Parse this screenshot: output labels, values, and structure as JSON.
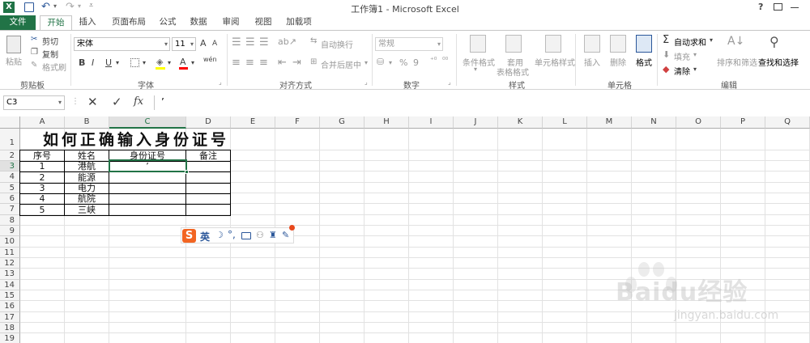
{
  "window": {
    "title": "工作簿1 - Microsoft Excel",
    "controls": [
      "?",
      "⊡",
      "—",
      "❐"
    ]
  },
  "tabs": [
    "文件",
    "开始",
    "插入",
    "页面布局",
    "公式",
    "数据",
    "审阅",
    "视图",
    "加载项"
  ],
  "ribbon": {
    "clipboard": {
      "paste": "粘贴",
      "cut": "剪切",
      "copy": "复制",
      "format_painter": "格式刷",
      "label": "剪贴板"
    },
    "font": {
      "name": "宋体",
      "size": "11",
      "bold": "B",
      "italic": "I",
      "underline": "U",
      "grow": "A",
      "shrink": "A",
      "label": "字体",
      "wen": "wén"
    },
    "alignment": {
      "wrap": "自动换行",
      "merge": "合并后居中",
      "label": "对齐方式"
    },
    "number": {
      "format": "常规",
      "percent": "%",
      "comma": "9",
      "label": "数字"
    },
    "styles": {
      "cond": "条件格式",
      "table": "套用",
      "table2": "表格格式",
      "cell": "单元格样式",
      "label": "样式"
    },
    "cells": {
      "insert": "插入",
      "delete": "删除",
      "format": "格式",
      "label": "单元格"
    },
    "editing": {
      "autosum": "自动求和",
      "fill": "填充",
      "clear": "清除",
      "sort": "排序和筛选",
      "find": "查找和选择",
      "label": "编辑"
    }
  },
  "formula_bar": {
    "name_box": "C3",
    "cancel": "✕",
    "enter": "✓",
    "fx": "fx",
    "content": "’"
  },
  "columns": [
    "A",
    "B",
    "C",
    "D",
    "E",
    "F",
    "G",
    "H",
    "I",
    "J",
    "K",
    "L",
    "M",
    "N",
    "O",
    "P",
    "Q"
  ],
  "rows": [
    "1",
    "2",
    "3",
    "4",
    "5",
    "6",
    "7",
    "8",
    "9",
    "10",
    "11",
    "12",
    "13",
    "14",
    "15",
    "16",
    "17",
    "18",
    "19"
  ],
  "sheet": {
    "title": "如何正确输入身份证号",
    "headers": [
      "序号",
      "姓名",
      "身份证号",
      "备注"
    ],
    "data": [
      [
        "1",
        "港航",
        "’",
        ""
      ],
      [
        "2",
        "能源",
        "",
        ""
      ],
      [
        "3",
        "电力",
        "",
        ""
      ],
      [
        "4",
        "航院",
        "",
        ""
      ],
      [
        "5",
        "三峡",
        "",
        ""
      ]
    ]
  },
  "ime": {
    "logo": "S",
    "mode": "英"
  },
  "watermark": {
    "brand": "Baidu经验",
    "url": "jingyan.baidu.com"
  },
  "colors": {
    "accent": "#217346",
    "ime_orange": "#f26522"
  }
}
